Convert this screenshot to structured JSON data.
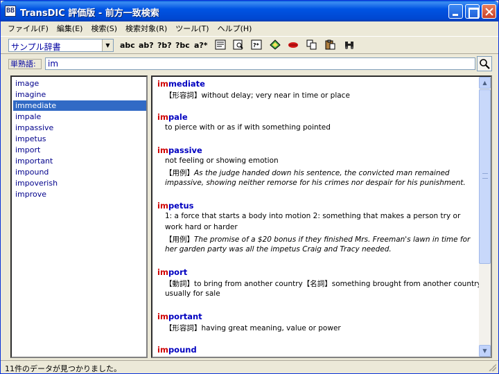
{
  "window": {
    "title": "TransDIC 評価版 - 前方一致検索",
    "icon_text": "BB"
  },
  "menu": [
    "ファイル(F)",
    "編集(E)",
    "検索(S)",
    "検索対象(R)",
    "ツール(T)",
    "ヘルプ(H)"
  ],
  "toolbar": {
    "dictionary_select": "サンプル辞書",
    "search_modes": [
      "abc",
      "ab?",
      "?b?",
      "?bc",
      "a?*"
    ],
    "icons": [
      "list-view-icon",
      "lookup-icon",
      "wildcard-icon",
      "bookmark-icon",
      "lips-icon",
      "copy-icon",
      "paste-icon",
      "binoculars-icon"
    ]
  },
  "search": {
    "label": "単熟語:",
    "value": "im"
  },
  "word_list": {
    "items": [
      "image",
      "imagine",
      "immediate",
      "impale",
      "impassive",
      "impetus",
      "import",
      "important",
      "impound",
      "impoverish",
      "improve"
    ],
    "selected": "immediate"
  },
  "entries": [
    {
      "match": "im",
      "rest": "mediate",
      "lines": [
        {
          "type": "def",
          "text": "【形容詞】without delay; very near in time or place"
        }
      ]
    },
    {
      "match": "im",
      "rest": "pale",
      "lines": [
        {
          "type": "def",
          "text": "to pierce with or as if with something pointed"
        }
      ]
    },
    {
      "match": "im",
      "rest": "passive",
      "lines": [
        {
          "type": "def",
          "text": "not feeling or showing emotion"
        },
        {
          "type": "ex",
          "tag": "【用例】",
          "text": "As the judge handed down his sentence, the convicted man remained"
        },
        {
          "type": "ex",
          "tag": "",
          "text": "impassive, showing neither remorse for his crimes nor despair for his punishment."
        }
      ]
    },
    {
      "match": "im",
      "rest": "petus",
      "lines": [
        {
          "type": "def",
          "text": "1: a force that starts a body into motion 2: something that makes a person try or"
        },
        {
          "type": "def",
          "text": "work hard or harder"
        },
        {
          "type": "ex",
          "tag": "【用例】",
          "text": "The promise of a $20 bonus if they finished Mrs. Freeman's lawn in time for"
        },
        {
          "type": "ex",
          "tag": "",
          "text": "her garden party was all the impetus Craig and Tracy needed."
        }
      ]
    },
    {
      "match": "im",
      "rest": "port",
      "lines": [
        {
          "type": "def",
          "text": "【動詞】to bring from another country【名詞】something brought from another country,"
        },
        {
          "type": "def",
          "text": "usually for sale"
        }
      ]
    },
    {
      "match": "im",
      "rest": "portant",
      "lines": [
        {
          "type": "def",
          "text": "【形容詞】having great meaning, value or power"
        }
      ]
    },
    {
      "match": "im",
      "rest": "pound",
      "lines": []
    }
  ],
  "status": {
    "text": "11件のデータが見つかりました。"
  }
}
